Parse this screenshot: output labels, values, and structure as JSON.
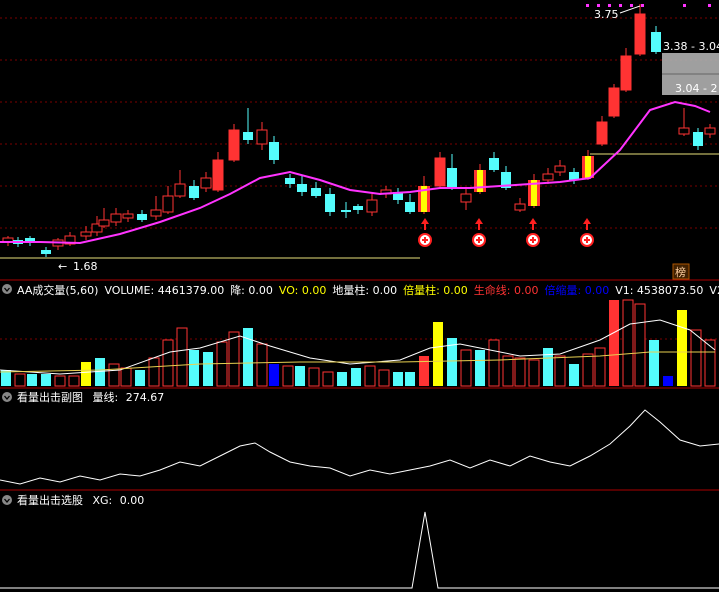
{
  "colors": {
    "bg": "#000000",
    "up": "#ff3333",
    "down": "#54fcfc",
    "ma": "#ff33ff",
    "grid": "#7a0000",
    "panel_border": "#aa0000",
    "white": "#ffffff",
    "yellow": "#ffff00",
    "blue": "#0000ff",
    "gray_box": "#b4b4b4"
  },
  "main_chart": {
    "price_labels": {
      "high": "3.75",
      "low": "1.68",
      "box1": "3.38 - 3.04",
      "box2": "3.04 - 2"
    },
    "badge": "榜",
    "low_arrow": "←"
  },
  "indicator_volume": {
    "name": "AA成交量(5,60)",
    "items": [
      {
        "label": "VOLUME:",
        "value": "4461379.00",
        "color": "#ffffff"
      },
      {
        "label": "降:",
        "value": "0.00",
        "color": "#ffffff"
      },
      {
        "label": "VO:",
        "value": "0.00",
        "color": "#ffff00"
      },
      {
        "label": "地量柱:",
        "value": "0.00",
        "color": "#ffffff"
      },
      {
        "label": "倍量柱:",
        "value": "0.00",
        "color": "#ffff00"
      },
      {
        "label": "生命线:",
        "value": "0.00",
        "color": "#ff3333"
      },
      {
        "label": "倍缩量:",
        "value": "0.00",
        "color": "#0000ff"
      },
      {
        "label": "V1:",
        "value": "4538073.50",
        "color": "#ffffff"
      },
      {
        "label": "V2",
        "value": "",
        "color": "#ffffff"
      }
    ]
  },
  "indicator_sub": {
    "name": "看量出击副图",
    "label": "量线:",
    "value": "274.67"
  },
  "indicator_select": {
    "name": "看量出击选股",
    "label": "XG:",
    "value": "0.00"
  }
}
